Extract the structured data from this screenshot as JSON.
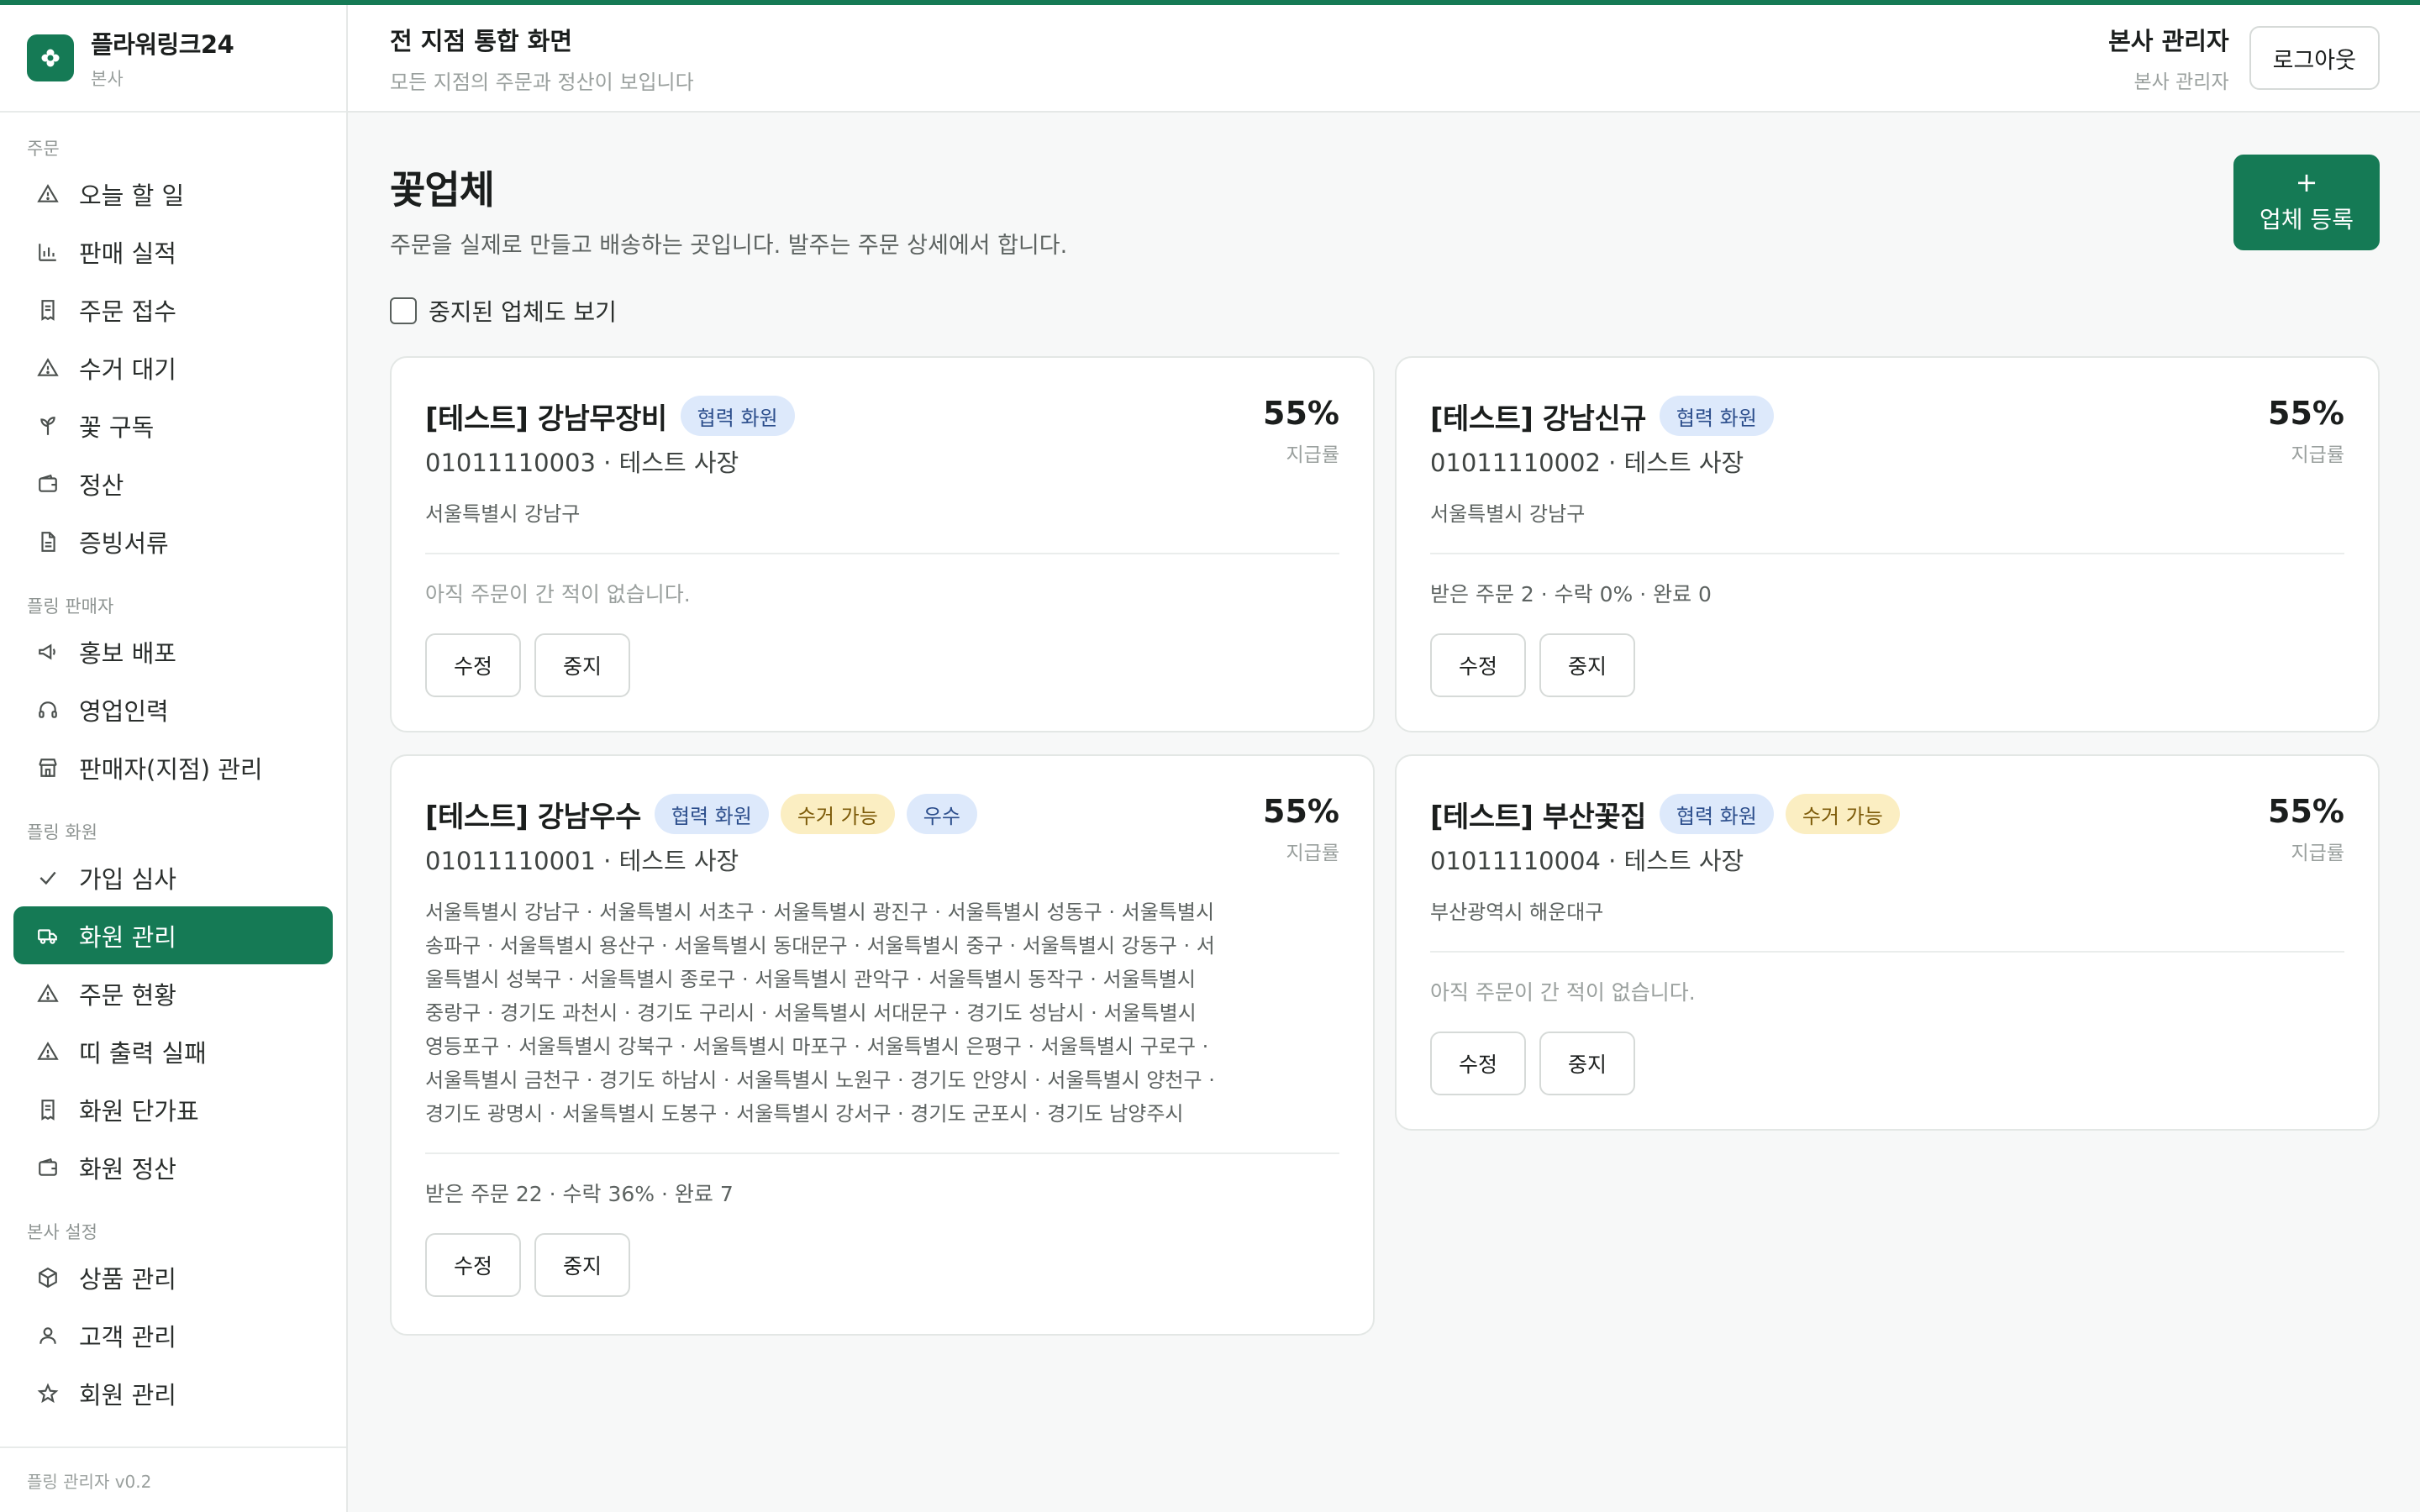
{
  "brand": {
    "name": "플라워링크24",
    "sub": "본사"
  },
  "sidebar": {
    "sections": [
      {
        "label": "주문",
        "items": [
          {
            "label": "오늘 할 일",
            "icon": "alert-triangle-icon"
          },
          {
            "label": "판매 실적",
            "icon": "bar-chart-icon"
          },
          {
            "label": "주문 접수",
            "icon": "receipt-icon"
          },
          {
            "label": "수거 대기",
            "icon": "alert-triangle-icon"
          },
          {
            "label": "꽃 구독",
            "icon": "sprout-icon"
          },
          {
            "label": "정산",
            "icon": "wallet-icon"
          },
          {
            "label": "증빙서류",
            "icon": "file-icon"
          }
        ]
      },
      {
        "label": "플링 판매자",
        "items": [
          {
            "label": "홍보 배포",
            "icon": "megaphone-icon"
          },
          {
            "label": "영업인력",
            "icon": "headset-icon"
          },
          {
            "label": "판매자(지점) 관리",
            "icon": "store-icon"
          }
        ]
      },
      {
        "label": "플링 화원",
        "items": [
          {
            "label": "가입 심사",
            "icon": "check-icon"
          },
          {
            "label": "화원 관리",
            "icon": "truck-icon",
            "active": true
          },
          {
            "label": "주문 현황",
            "icon": "alert-triangle-icon"
          },
          {
            "label": "띠 출력 실패",
            "icon": "alert-triangle-icon"
          },
          {
            "label": "화원 단가표",
            "icon": "receipt-icon"
          },
          {
            "label": "화원 정산",
            "icon": "wallet-icon"
          }
        ]
      },
      {
        "label": "본사 설정",
        "items": [
          {
            "label": "상품 관리",
            "icon": "box-icon"
          },
          {
            "label": "고객 관리",
            "icon": "user-icon"
          },
          {
            "label": "회원 관리",
            "icon": "star-icon"
          }
        ]
      }
    ],
    "footer": "플링 관리자 v0.2"
  },
  "header": {
    "title": "전 지점 통합 화면",
    "subtitle": "모든 지점의 주문과 정산이 보입니다",
    "user_name": "본사 관리자",
    "user_role": "본사 관리자",
    "logout_label": "로그아웃"
  },
  "main": {
    "title": "꽃업체",
    "description": "주문을 실제로 만들고 배송하는 곳입니다. 발주는 주문 상세에서 합니다.",
    "add_button_plus": "+",
    "add_button_label": "업체 등록",
    "filter_label": "중지된 업체도 보기",
    "filter_checked": false,
    "edit_label": "수정",
    "suspend_label": "중지",
    "rate_label": "지급률",
    "cards": [
      {
        "name": "[테스트] 강남무장비",
        "badges": [
          {
            "text": "협력 화원",
            "color": "blue"
          }
        ],
        "rate": "55%",
        "contact": "01011110003 · 테스트 사장",
        "region": "서울특별시 강남구",
        "stats": "아직 주문이 간 적이 없습니다.",
        "stats_muted": true
      },
      {
        "name": "[테스트] 강남신규",
        "badges": [
          {
            "text": "협력 화원",
            "color": "blue"
          }
        ],
        "rate": "55%",
        "contact": "01011110002 · 테스트 사장",
        "region": "서울특별시 강남구",
        "stats": "받은 주문 2 · 수락 0% · 완료 0",
        "stats_muted": false
      },
      {
        "name": "[테스트] 강남우수",
        "badges": [
          {
            "text": "협력 화원",
            "color": "blue"
          },
          {
            "text": "수거 가능",
            "color": "yellow"
          },
          {
            "text": "우수",
            "color": "blue"
          }
        ],
        "rate": "55%",
        "contact": "01011110001 · 테스트 사장",
        "region": "서울특별시 강남구 · 서울특별시 서초구 · 서울특별시 광진구 · 서울특별시 성동구 · 서울특별시 송파구 · 서울특별시 용산구 · 서울특별시 동대문구 · 서울특별시 중구 · 서울특별시 강동구 · 서울특별시 성북구 · 서울특별시 종로구 · 서울특별시 관악구 · 서울특별시 동작구 · 서울특별시 중랑구 · 경기도 과천시 · 경기도 구리시 · 서울특별시 서대문구 · 경기도 성남시 · 서울특별시 영등포구 · 서울특별시 강북구 · 서울특별시 마포구 · 서울특별시 은평구 · 서울특별시 구로구 · 서울특별시 금천구 · 경기도 하남시 · 서울특별시 노원구 · 경기도 안양시 · 서울특별시 양천구 · 경기도 광명시 · 서울특별시 도봉구 · 서울특별시 강서구 · 경기도 군포시 · 경기도 남양주시",
        "stats": "받은 주문 22 · 수락 36% · 완료 7",
        "stats_muted": false
      },
      {
        "name": "[테스트] 부산꽃집",
        "badges": [
          {
            "text": "협력 화원",
            "color": "blue"
          },
          {
            "text": "수거 가능",
            "color": "yellow"
          }
        ],
        "rate": "55%",
        "contact": "01011110004 · 테스트 사장",
        "region": "부산광역시 해운대구",
        "stats": "아직 주문이 간 적이 없습니다.",
        "stats_muted": true
      }
    ]
  }
}
